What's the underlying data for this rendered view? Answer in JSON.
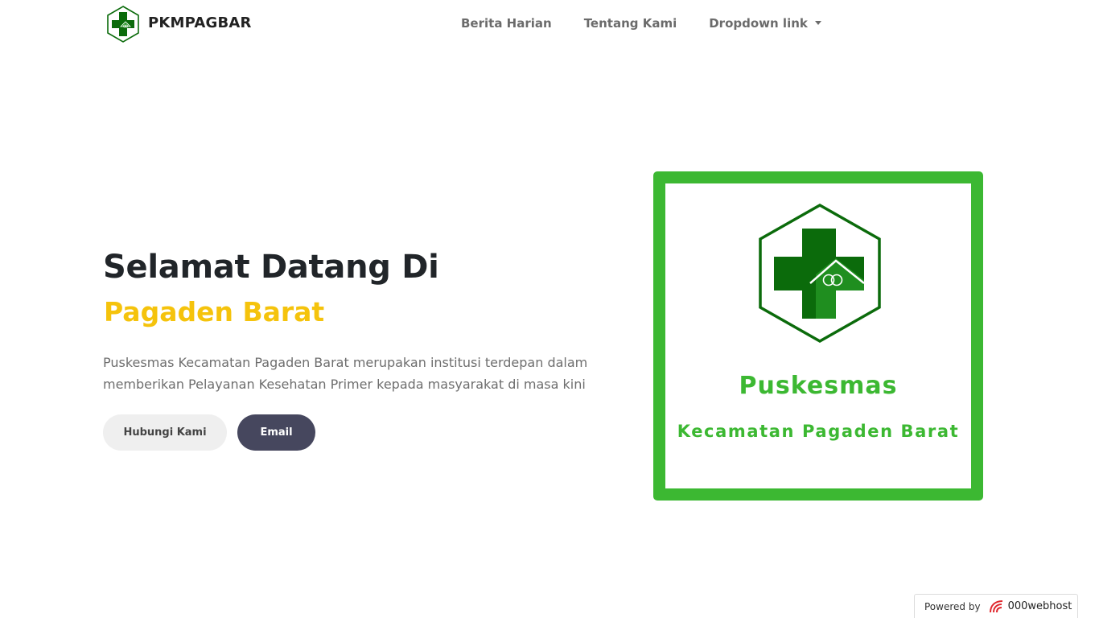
{
  "navbar": {
    "brand_name": "PKMPAGBAR",
    "links": [
      {
        "label": "Berita Harian"
      },
      {
        "label": "Tentang Kami"
      },
      {
        "label": "Dropdown link"
      }
    ]
  },
  "hero": {
    "title": "Selamat Datang Di",
    "subtitle": "Pagaden Barat",
    "description": "Puskesmas Kecamatan Pagaden Barat merupakan institusi terdepan dalam memberikan Pelayanan Kesehatan Primer kepada masyarakat di masa kini",
    "buttons": {
      "contact": "Hubungi Kami",
      "email": "Email"
    }
  },
  "logo_card": {
    "line1": "Puskesmas",
    "line2": "Kecamatan Pagaden Barat"
  },
  "footer_badge": {
    "powered_by": "Powered by",
    "host": "000webhost"
  },
  "colors": {
    "accent_yellow": "#f5c30c",
    "brand_green": "#3cb832",
    "dark_green": "#0b6b0b",
    "email_button": "#46475e"
  },
  "icons": {
    "brand": "puskesmas-logo-icon",
    "dropdown": "caret-down-icon",
    "host": "000webhost-icon"
  }
}
